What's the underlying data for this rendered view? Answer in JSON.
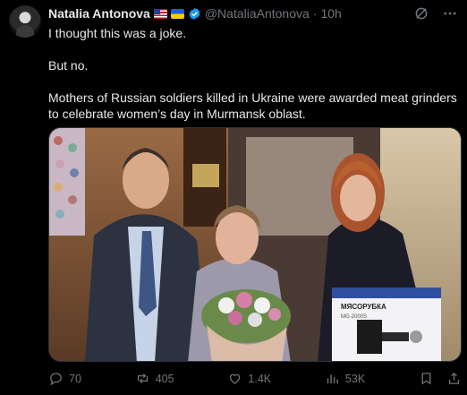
{
  "author": {
    "name": "Natalia Antonova",
    "handle": "@NataliaAntonova",
    "separator": "·",
    "time": "10h"
  },
  "tweet": {
    "paragraphs": [
      "I thought this was a joke.",
      "But no.",
      "Mothers of Russian soldiers killed in Ukraine were awarded meat grinders to celebrate women’s day in Murmansk oblast."
    ]
  },
  "media": {
    "box_brand": "МЯСОРУБКА",
    "box_model": "MG-2000S"
  },
  "stats": {
    "replies": "70",
    "reposts": "405",
    "likes": "1.4K",
    "views": "53K"
  },
  "colors": {
    "background": "#000000",
    "text": "#e7e9ea",
    "muted": "#71767b",
    "verified": "#1d9bf0"
  },
  "icons": [
    "grok-icon",
    "more-icon",
    "reply-icon",
    "repost-icon",
    "like-icon",
    "views-icon",
    "bookmark-icon",
    "share-icon",
    "verified-badge-icon",
    "flag-us-icon",
    "flag-ua-icon"
  ]
}
